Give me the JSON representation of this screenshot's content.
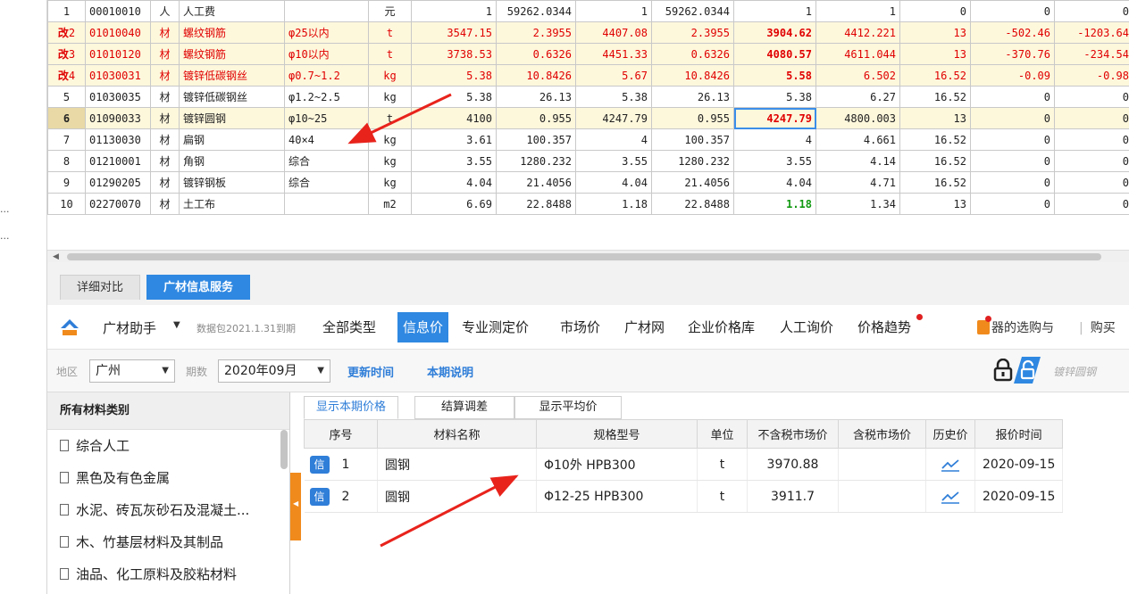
{
  "sidebar_dots": [
    "...",
    "..."
  ],
  "grid_rows": [
    {
      "kind": "",
      "no": "1",
      "code": "00010010",
      "type": "人",
      "name": "人工费",
      "spec": "",
      "unit": "元",
      "c1": "1",
      "c2": "59262.0344",
      "c3": "1",
      "c4": "59262.0344",
      "c5": "1",
      "c6": "1",
      "c7": "0",
      "c8": "0",
      "c9": "0"
    },
    {
      "kind": "改",
      "no": "2",
      "code": "01010040",
      "type": "材",
      "name": "螺纹钢筋",
      "spec": "φ25以内",
      "unit": "t",
      "c1": "3547.15",
      "c2": "2.3955",
      "c3": "4407.08",
      "c4": "2.3955",
      "c5": "3904.62",
      "c6": "4412.221",
      "c7": "13",
      "c8": "-502.46",
      "c9": "-1203.64"
    },
    {
      "kind": "改",
      "no": "3",
      "code": "01010120",
      "type": "材",
      "name": "螺纹钢筋",
      "spec": "φ10以内",
      "unit": "t",
      "c1": "3738.53",
      "c2": "0.6326",
      "c3": "4451.33",
      "c4": "0.6326",
      "c5": "4080.57",
      "c6": "4611.044",
      "c7": "13",
      "c8": "-370.76",
      "c9": "-234.54"
    },
    {
      "kind": "改",
      "no": "4",
      "code": "01030031",
      "type": "材",
      "name": "镀锌低碳钢丝",
      "spec": "φ0.7~1.2",
      "unit": "kg",
      "c1": "5.38",
      "c2": "10.8426",
      "c3": "5.67",
      "c4": "10.8426",
      "c5": "5.58",
      "c6": "6.502",
      "c7": "16.52",
      "c8": "-0.09",
      "c9": "-0.98"
    },
    {
      "kind": "",
      "no": "5",
      "code": "01030035",
      "type": "材",
      "name": "镀锌低碳钢丝",
      "spec": "φ1.2~2.5",
      "unit": "kg",
      "c1": "5.38",
      "c2": "26.13",
      "c3": "5.38",
      "c4": "26.13",
      "c5": "5.38",
      "c6": "6.27",
      "c7": "16.52",
      "c8": "0",
      "c9": "0"
    },
    {
      "kind": "",
      "no": "6",
      "code": "01090033",
      "type": "材",
      "name": "镀锌圆钢",
      "spec": "φ10~25",
      "unit": "t",
      "c1": "4100",
      "c2": "0.955",
      "c3": "4247.79",
      "c4": "0.955",
      "c5": "4247.79",
      "c6": "4800.003",
      "c7": "13",
      "c8": "0",
      "c9": "0"
    },
    {
      "kind": "",
      "no": "7",
      "code": "01130030",
      "type": "材",
      "name": "扁钢",
      "spec": "40×4",
      "unit": "kg",
      "c1": "3.61",
      "c2": "100.357",
      "c3": "4",
      "c4": "100.357",
      "c5": "4",
      "c6": "4.661",
      "c7": "16.52",
      "c8": "0",
      "c9": "0"
    },
    {
      "kind": "",
      "no": "8",
      "code": "01210001",
      "type": "材",
      "name": "角钢",
      "spec": "综合",
      "unit": "kg",
      "c1": "3.55",
      "c2": "1280.232",
      "c3": "3.55",
      "c4": "1280.232",
      "c5": "3.55",
      "c6": "4.14",
      "c7": "16.52",
      "c8": "0",
      "c9": "0"
    },
    {
      "kind": "",
      "no": "9",
      "code": "01290205",
      "type": "材",
      "name": "镀锌钢板",
      "spec": "综合",
      "unit": "kg",
      "c1": "4.04",
      "c2": "21.4056",
      "c3": "4.04",
      "c4": "21.4056",
      "c5": "4.04",
      "c6": "4.71",
      "c7": "16.52",
      "c8": "0",
      "c9": "0"
    },
    {
      "kind": "",
      "no": "10",
      "code": "02270070",
      "type": "材",
      "name": "土工布",
      "spec": "",
      "unit": "m2",
      "c1": "6.69",
      "c2": "22.8488",
      "c3": "1.18",
      "c4": "22.8488",
      "c5": "1.18",
      "c6": "1.34",
      "c7": "13",
      "c8": "0",
      "c9": "0"
    }
  ],
  "bottom_tabs": [
    "详细对比",
    "广材信息服务"
  ],
  "toolbar": {
    "brand": "广材助手",
    "brand_caret": "▼",
    "package_info": "数据包2021.1.31到期",
    "nav": [
      "全部类型",
      "信息价",
      "专业测定价",
      "市场价",
      "广材网",
      "企业价格库",
      "人工询价",
      "价格趋势"
    ],
    "promo": "器的选购与",
    "buy": "购买",
    "buy_sep": "|"
  },
  "filter": {
    "region_label": "地区",
    "region_value": "广州",
    "period_label": "期数",
    "period_value": "2020年09月",
    "update_time": "更新时间",
    "period_note": "本期说明",
    "search_placeholder": "镀锌圆钢"
  },
  "categories": {
    "title": "所有材料类别",
    "items": [
      "综合人工",
      "黑色及有色金属",
      "水泥、砖瓦灰砂石及混凝土...",
      "木、竹基层材料及其制品",
      "油品、化工原料及胶粘材料"
    ]
  },
  "sub_tabs": [
    "显示本期价格",
    "结算调差",
    "显示平均价"
  ],
  "lower_headers": [
    "序号",
    "材料名称",
    "规格型号",
    "单位",
    "不含税市场价",
    "含税市场价",
    "历史价",
    "报价时间"
  ],
  "lower_rows": [
    {
      "badge": "信",
      "no": "1",
      "name": "圆钢",
      "spec": "Φ10外 HPB300",
      "unit": "t",
      "price": "3970.88",
      "tax_price": "",
      "date": "2020-09-15"
    },
    {
      "badge": "信",
      "no": "2",
      "name": "圆钢",
      "spec": "Φ12-25 HPB300",
      "unit": "t",
      "price": "3911.7",
      "tax_price": "",
      "date": "2020-09-15"
    }
  ],
  "colors": {
    "accent": "#2f88e1",
    "changed_text": "#e00000",
    "orange": "#f08a1c",
    "annotation_arrow": "#e8231c"
  },
  "icons": [
    "scroll-left-icon",
    "logo-icon",
    "lock-icon",
    "unlock-icon",
    "document-icon",
    "trend-chart-icon",
    "book-icon",
    "collapse-arrow-icon"
  ]
}
